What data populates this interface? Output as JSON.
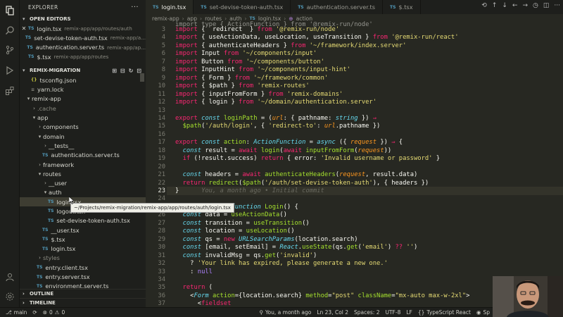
{
  "explorer": {
    "title": "EXPLORER",
    "open_editors_title": "OPEN EDITORS",
    "open_editors": [
      {
        "name": "login.tsx",
        "path": "remix-app/app/routes/auth",
        "active": true
      },
      {
        "name": "set-devise-token-auth.tsx",
        "path": "remix-app/a..."
      },
      {
        "name": "authentication.server.ts",
        "path": "remix-app/ap..."
      },
      {
        "name": "$.tsx",
        "path": "remix-app/app/routes"
      }
    ],
    "project_title": "REMIX-MIGRATION",
    "tree": [
      {
        "label": "tsconfig.json",
        "level": 2,
        "type": "json"
      },
      {
        "label": "yarn.lock",
        "level": 2,
        "type": "lock"
      },
      {
        "label": "remix-app",
        "level": 1,
        "type": "folder-open"
      },
      {
        "label": ".cache",
        "level": 2,
        "type": "folder",
        "dim": true
      },
      {
        "label": "app",
        "level": 2,
        "type": "folder-open"
      },
      {
        "label": "components",
        "level": 3,
        "type": "folder"
      },
      {
        "label": "domain",
        "level": 3,
        "type": "folder-open"
      },
      {
        "label": "__tests__",
        "level": 4,
        "type": "folder"
      },
      {
        "label": "authentication.server.ts",
        "level": 4,
        "type": "ts"
      },
      {
        "label": "framework",
        "level": 3,
        "type": "folder"
      },
      {
        "label": "routes",
        "level": 3,
        "type": "folder-open"
      },
      {
        "label": "__user",
        "level": 4,
        "type": "folder"
      },
      {
        "label": "auth",
        "level": 4,
        "type": "folder-open"
      },
      {
        "label": "login.tsx",
        "level": 5,
        "type": "ts",
        "selected": true
      },
      {
        "label": "logout.tsx",
        "level": 5,
        "type": "ts"
      },
      {
        "label": "set-devise-token-auth.tsx",
        "level": 5,
        "type": "ts"
      },
      {
        "label": "__user.tsx",
        "level": 4,
        "type": "ts"
      },
      {
        "label": "$.tsx",
        "level": 4,
        "type": "ts"
      },
      {
        "label": "login.tsx",
        "level": 4,
        "type": "ts"
      },
      {
        "label": "styles",
        "level": 3,
        "type": "folder",
        "dim": true
      },
      {
        "label": "entry.client.tsx",
        "level": 3,
        "type": "ts"
      },
      {
        "label": "entry.server.tsx",
        "level": 3,
        "type": "ts"
      },
      {
        "label": "environment.server.ts",
        "level": 3,
        "type": "ts"
      }
    ],
    "outline_title": "OUTLINE",
    "timeline_title": "TIMELINE",
    "tooltip": "~/Projects/remix-migration/remix-app/app/routes/auth/login.tsx"
  },
  "tabs": [
    {
      "label": "login.tsx",
      "active": true
    },
    {
      "label": "set-devise-token-auth.tsx"
    },
    {
      "label": "authentication.server.ts"
    },
    {
      "label": "$.tsx"
    }
  ],
  "breadcrumb": [
    "remix-app",
    "app",
    "routes",
    "auth",
    "login.tsx",
    "action"
  ],
  "code_lines": [
    {
      "n": 3,
      "h": "<span class=\"k\">import</span> {  redirect  } <span class=\"k\">from</span> <span class=\"s\">'@remix-run/node'</span>"
    },
    {
      "n": 4,
      "h": "<span class=\"k\">import</span> { useActionData, useLocation, useTransition } <span class=\"k\">from</span> <span class=\"s\">'@remix-run/react'</span>"
    },
    {
      "n": 5,
      "h": "<span class=\"k\">import</span> { authenticateHeaders } <span class=\"k\">from</span> <span class=\"s\">'~/framework/index.server'</span>"
    },
    {
      "n": 6,
      "h": "<span class=\"k\">import</span> Input <span class=\"k\">from</span> <span class=\"s\">'~/components/input'</span>"
    },
    {
      "n": 7,
      "h": "<span class=\"k\">import</span> Button <span class=\"k\">from</span> <span class=\"s\">'~/components/button'</span>"
    },
    {
      "n": 8,
      "h": "<span class=\"k\">import</span> InputHint <span class=\"k\">from</span> <span class=\"s\">'~/components/input-hint'</span>"
    },
    {
      "n": 9,
      "h": "<span class=\"k\">import</span> { Form } <span class=\"k\">from</span> <span class=\"s\">'~/framework/common'</span>"
    },
    {
      "n": 10,
      "h": "<span class=\"k\">import</span> { $path } <span class=\"k\">from</span> <span class=\"s\">'remix-routes'</span>"
    },
    {
      "n": 11,
      "h": "<span class=\"k\">import</span> { inputFromForm } <span class=\"k\">from</span> <span class=\"s\">'remix-domains'</span>"
    },
    {
      "n": 12,
      "h": "<span class=\"k\">import</span> { login } <span class=\"k\">from</span> <span class=\"s\">'~/domain/authentication.server'</span>"
    },
    {
      "n": 13,
      "h": ""
    },
    {
      "n": 14,
      "h": "<span class=\"k\">export</span> <span class=\"t\">const</span> <span class=\"f\">loginPath</span> = (<span class=\"p\">url</span>: { pathname: <span class=\"t\">string</span> }) <span class=\"k\">⇒</span>"
    },
    {
      "n": 15,
      "h": "  <span class=\"f\">$path</span>(<span class=\"s\">'/auth/login'</span>, { <span class=\"s\">'redirect-to'</span>: <span class=\"p\">url</span>.pathname })"
    },
    {
      "n": 16,
      "h": ""
    },
    {
      "n": 17,
      "h": "<span class=\"k\">export</span> <span class=\"t\">const</span> <span class=\"f\">action</span>: <span class=\"t\">ActionFunction</span> = <span class=\"t\">async</span> ({ <span class=\"p\">request</span> }) <span class=\"k\">⇒</span> {"
    },
    {
      "n": 18,
      "h": "  <span class=\"t\">const</span> result = <span class=\"k\">await</span> <span class=\"f\">login</span>(<span class=\"k\">await</span> <span class=\"f\">inputFromForm</span>(<span class=\"p\">request</span>))"
    },
    {
      "n": 19,
      "h": "  <span class=\"k\">if</span> (!result.success) <span class=\"k\">return</span> { error: <span class=\"s\">'Invalid username or password'</span> }"
    },
    {
      "n": 20,
      "h": ""
    },
    {
      "n": 21,
      "h": "  <span class=\"t\">const</span> headers = <span class=\"k\">await</span> <span class=\"f\">authenticateHeaders</span>(<span class=\"p\">request</span>, result.data)"
    },
    {
      "n": 22,
      "h": "  <span class=\"k\">return</span> <span class=\"f\">redirect</span>(<span class=\"f\">$path</span>(<span class=\"s\">'/auth/set-devise-token-auth'</span>), { headers })"
    },
    {
      "n": 23,
      "h": "}      <span class=\"ghost\">You, a month ago • Initial commit</span>"
    },
    {
      "n": 24,
      "h": ""
    },
    {
      "n": 25,
      "h": "<span class=\"k\">export</span> <span class=\"k\">default</span> <span class=\"t\">function</span> <span class=\"f\">Login</span>() {"
    },
    {
      "n": 26,
      "h": "  <span class=\"t\">const</span> data = <span class=\"f\">useActionData</span>()"
    },
    {
      "n": 27,
      "h": "  <span class=\"t\">const</span> transition = <span class=\"f\">useTransition</span>()"
    },
    {
      "n": 28,
      "h": "  <span class=\"t\">const</span> location = <span class=\"f\">useLocation</span>()"
    },
    {
      "n": 29,
      "h": "  <span class=\"t\">const</span> qs = <span class=\"k\">new</span> <span class=\"t\">URLSearchParams</span>(location.search)"
    },
    {
      "n": 30,
      "h": "  <span class=\"t\">const</span> [email, setEmail] = <span class=\"t\">React</span>.<span class=\"f\">useState</span>(qs.<span class=\"f\">get</span>(<span class=\"s\">'email'</span>) <span class=\"k\">??</span> <span class=\"s\">''</span>)"
    },
    {
      "n": 31,
      "h": "  <span class=\"t\">const</span> invalidMsg = qs.<span class=\"f\">get</span>(<span class=\"s\">'invalid'</span>)"
    },
    {
      "n": 32,
      "h": "    ? <span class=\"s\">'Your link has expired, please generate a new one.'</span>"
    },
    {
      "n": 33,
      "h": "    : <span class=\"n\">null</span>"
    },
    {
      "n": 34,
      "h": ""
    },
    {
      "n": 35,
      "h": "  <span class=\"k\">return</span> ("
    },
    {
      "n": 36,
      "h": "    &lt;<span class=\"t\">Form</span> <span class=\"f\">action</span>={location.search} <span class=\"f\">method</span>=<span class=\"s\">\"post\"</span> <span class=\"f\">className</span>=<span class=\"s\">\"mx-auto max-w-2xl\"</span>&gt;"
    },
    {
      "n": 37,
      "h": "      &lt;<span class=\"k\">fieldset</span>"
    }
  ],
  "current_line": 23,
  "partial_top_line": "import type { ActionFunction } from '@remix-run/node'",
  "status": {
    "branch": "main",
    "errors": "0",
    "warnings": "0",
    "blame": "You, a month ago",
    "position": "Ln 23, Col 2",
    "spaces": "Spaces: 2",
    "encoding": "UTF-8",
    "eol": "LF",
    "language": "TypeScript React",
    "extra": "Sp"
  },
  "colors": {
    "keyword": "#f92672",
    "string": "#e6db74",
    "function": "#a6e22e",
    "param": "#fd971f",
    "type": "#66d9ef",
    "background": "#272822"
  }
}
